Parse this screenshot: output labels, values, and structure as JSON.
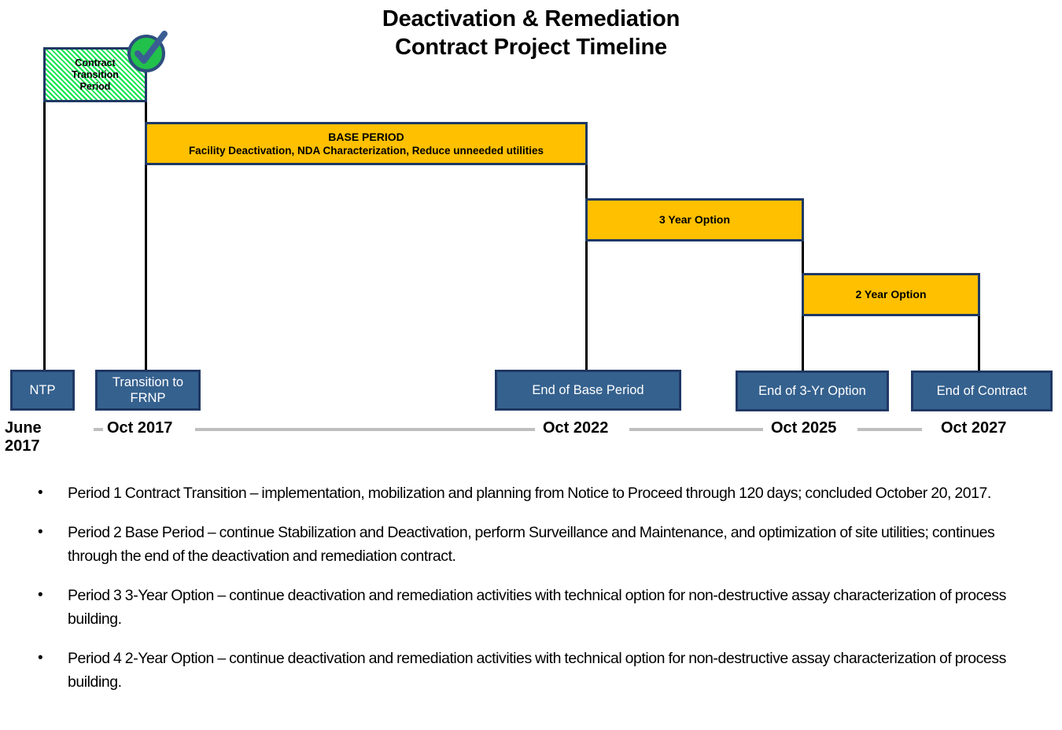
{
  "title": {
    "line1": "Deactivation & Remediation",
    "line2": "Contract Project Timeline"
  },
  "colors": {
    "bar_orange": "#FFC000",
    "bar_border_navy": "#1F3864",
    "milestone_blue": "#35618E",
    "hatch_green": "#00E34A",
    "axis_gray": "#BFBFBF",
    "connector_black": "#000000"
  },
  "bars": [
    {
      "id": "contract-transition-period",
      "title": "Contract",
      "title2": "Transition",
      "title3": "Period",
      "subtitle": "",
      "style": "hatched-green",
      "status": "complete",
      "start_label": "June 2017",
      "end_label": "Oct 2017"
    },
    {
      "id": "base-period",
      "title": "BASE PERIOD",
      "subtitle": "Facility Deactivation, NDA Characterization, Reduce unneeded utilities",
      "style": "orange",
      "start_label": "Oct 2017",
      "end_label": "Oct 2022"
    },
    {
      "id": "three-year-option",
      "title": "3 Year Option",
      "subtitle": "",
      "style": "orange",
      "start_label": "Oct 2022",
      "end_label": "Oct 2025"
    },
    {
      "id": "two-year-option",
      "title": "2 Year Option",
      "subtitle": "",
      "style": "orange",
      "start_label": "Oct 2025",
      "end_label": "Oct 2027"
    }
  ],
  "milestones": [
    {
      "id": "ntp",
      "label": "NTP",
      "date": "June 2017",
      "date_line1": "June",
      "date_line2": "2017"
    },
    {
      "id": "transition-to-frnp",
      "label": "Transition to FRNP",
      "label_line1": "Transition to",
      "label_line2": "FRNP",
      "date": "Oct 2017"
    },
    {
      "id": "end-of-base-period",
      "label": "End of Base Period",
      "date": "Oct 2022"
    },
    {
      "id": "end-of-3yr-option",
      "label": "End of 3-Yr Option",
      "date": "Oct 2025"
    },
    {
      "id": "end-of-contract",
      "label": "End of Contract",
      "date": "Oct 2027"
    }
  ],
  "check_badge": {
    "icon": "check-circle-icon",
    "meaning": "Contract Transition Period complete"
  },
  "bullets": [
    "Period 1 Contract Transition – implementation, mobilization and planning from Notice to Proceed through 120 days; concluded October 20, 2017.",
    "Period 2 Base Period – continue Stabilization and Deactivation, perform Surveillance and Maintenance, and optimization of site utilities; continues through the end of the deactivation and remediation contract.",
    "Period 3 3-Year Option – continue deactivation and remediation activities with technical option for non-destructive assay characterization of process building.",
    "Period 4 2-Year Option – continue deactivation and remediation activities with technical option for non-destructive assay characterization of process building."
  ],
  "chart_data": {
    "type": "bar",
    "title": "Deactivation & Remediation Contract Project Timeline",
    "orientation": "horizontal-gantt",
    "xlabel": "",
    "ylabel": "",
    "axis_ticks": [
      "June 2017",
      "Oct 2017",
      "Oct 2022",
      "Oct 2025",
      "Oct 2027"
    ],
    "grid": false,
    "legend": "none",
    "categories": [
      "Contract Transition Period",
      "BASE PERIOD",
      "3 Year Option",
      "2 Year Option"
    ],
    "series": [
      {
        "name": "Contract phases",
        "values": [
          {
            "label": "Contract Transition Period",
            "start": "June 2017",
            "end": "Oct 2017",
            "duration_months": 4,
            "color": "#00E34A",
            "pattern": "diagonal-hatch",
            "complete": true
          },
          {
            "label": "BASE PERIOD",
            "start": "Oct 2017",
            "end": "Oct 2022",
            "duration_months": 60,
            "color": "#FFC000",
            "pattern": "solid",
            "complete": false
          },
          {
            "label": "3 Year Option",
            "start": "Oct 2022",
            "end": "Oct 2025",
            "duration_months": 36,
            "color": "#FFC000",
            "pattern": "solid",
            "complete": false
          },
          {
            "label": "2 Year Option",
            "start": "Oct 2025",
            "end": "Oct 2027",
            "duration_months": 24,
            "color": "#FFC000",
            "pattern": "solid",
            "complete": false
          }
        ]
      }
    ],
    "annotations": [
      "NTP",
      "Transition to FRNP",
      "End of Base Period",
      "End of 3-Yr Option",
      "End of Contract"
    ]
  }
}
